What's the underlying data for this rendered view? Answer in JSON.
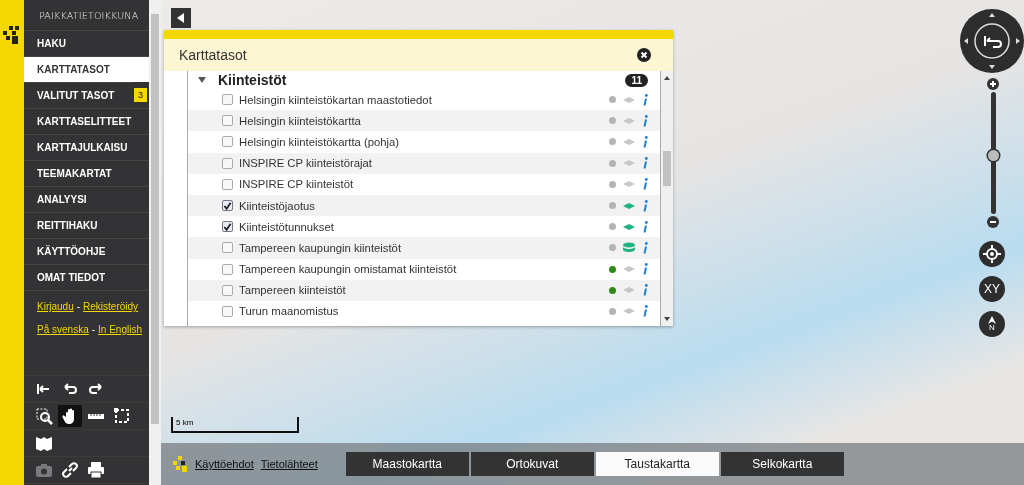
{
  "sidebar": {
    "title": "PAIKKATIETOIKKUNA",
    "items": [
      {
        "label": "HAKU",
        "selected": false
      },
      {
        "label": "KARTTATASOT",
        "selected": true
      },
      {
        "label": "VALITUT TASOT",
        "selected": false,
        "badge": "3"
      },
      {
        "label": "KARTTASELITTEET",
        "selected": false
      },
      {
        "label": "KARTTAJULKAISU",
        "selected": false
      },
      {
        "label": "TEEMAKARTAT",
        "selected": false
      },
      {
        "label": "ANALYYSI",
        "selected": false
      },
      {
        "label": "REITTIHAKU",
        "selected": false
      },
      {
        "label": "KÄYTTÖOHJE",
        "selected": false
      },
      {
        "label": "OMAT TIEDOT",
        "selected": false
      }
    ],
    "link_rows": [
      {
        "links": [
          "Kirjaudu",
          "Rekisteröidy"
        ],
        "separator": "-"
      },
      {
        "links": [
          "På svenska",
          "In English"
        ],
        "separator": "-"
      }
    ],
    "tool_rows": [
      [
        {
          "kind": "reset",
          "selected": false,
          "disabled": false
        },
        {
          "kind": "undo",
          "selected": false,
          "disabled": false
        },
        {
          "kind": "redo",
          "selected": false,
          "disabled": false
        }
      ],
      [
        {
          "kind": "zoombox",
          "selected": false,
          "disabled": false
        },
        {
          "kind": "pan",
          "selected": true,
          "disabled": false
        },
        {
          "kind": "measure",
          "selected": false,
          "disabled": false
        },
        {
          "kind": "select",
          "selected": false,
          "disabled": false
        }
      ],
      [
        {
          "kind": "book",
          "selected": false,
          "disabled": false
        }
      ],
      [
        {
          "kind": "camera",
          "selected": false,
          "disabled": true
        },
        {
          "kind": "link",
          "selected": false,
          "disabled": false
        },
        {
          "kind": "print",
          "selected": false,
          "disabled": false
        }
      ]
    ]
  },
  "panel": {
    "title": "Karttatasot",
    "group": {
      "name": "Kiinteistöt",
      "count": "11",
      "expanded": true,
      "layers": [
        {
          "name": "Helsingin kiinteistökartan maastotiedot",
          "checked": false,
          "color": "#b4b4b4",
          "kind": "layer",
          "visible": false
        },
        {
          "name": "Helsingin kiinteistökartta",
          "checked": false,
          "color": "#b4b4b4",
          "kind": "layer",
          "visible": false
        },
        {
          "name": "Helsingin kiinteistökartta (pohja)",
          "checked": false,
          "color": "#b4b4b4",
          "kind": "layer",
          "visible": false
        },
        {
          "name": "INSPIRE CP kiinteistörajat",
          "checked": false,
          "color": "#b4b4b4",
          "kind": "layer",
          "visible": false
        },
        {
          "name": "INSPIRE CP kiinteistöt",
          "checked": false,
          "color": "#b4b4b4",
          "kind": "layer",
          "visible": false
        },
        {
          "name": "Kiinteistöjaotus",
          "checked": true,
          "color": "#b4b4b4",
          "kind": "layer",
          "visible": true
        },
        {
          "name": "Kiinteistötunnukset",
          "checked": true,
          "color": "#b4b4b4",
          "kind": "layer",
          "visible": true
        },
        {
          "name": "Tampereen kaupungin kiinteistöt",
          "checked": false,
          "color": "#b4b4b4",
          "kind": "database",
          "visible": true
        },
        {
          "name": "Tampereen kaupungin omistamat kiinteistöt",
          "checked": false,
          "color": "#2e8b17",
          "kind": "layer",
          "visible": false
        },
        {
          "name": "Tampereen kiinteistöt",
          "checked": false,
          "color": "#2e8b17",
          "kind": "layer",
          "visible": false
        },
        {
          "name": "Turun maanomistus",
          "checked": false,
          "color": "#b4b4b4",
          "kind": "layer",
          "visible": false
        }
      ]
    }
  },
  "map": {
    "scale": "5 km",
    "zoom": {
      "level": 0.48
    },
    "xy_button": "XY",
    "north_label": "N"
  },
  "bottom_bar": {
    "links": [
      "Käyttöehdot",
      "Tietolähteet"
    ],
    "tabs": [
      {
        "label": "Maastokartta",
        "selected": false
      },
      {
        "label": "Ortokuvat",
        "selected": false
      },
      {
        "label": "Taustakartta",
        "selected": true
      },
      {
        "label": "Selkokartta",
        "selected": false
      }
    ]
  }
}
